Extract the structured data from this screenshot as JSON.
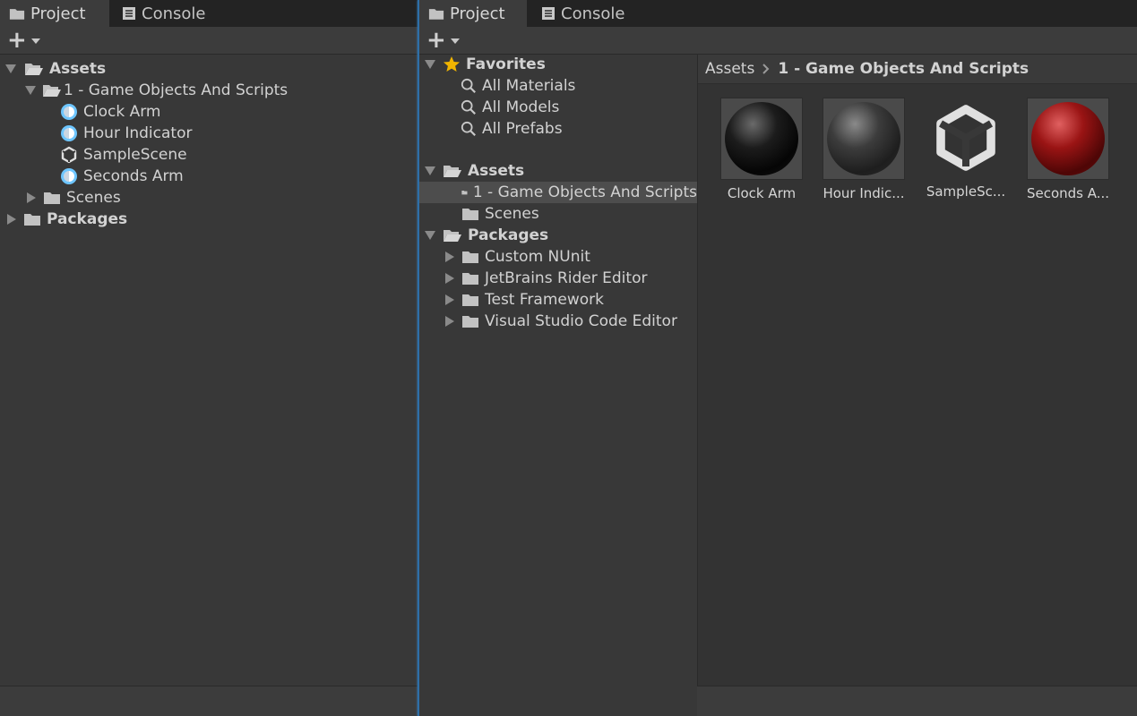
{
  "left": {
    "tabs": [
      {
        "label": "Project"
      },
      {
        "label": "Console"
      }
    ],
    "tree": {
      "assets": "Assets",
      "folder1": "1 - Game Objects And Scripts",
      "items": [
        "Clock Arm",
        "Hour Indicator",
        "SampleScene",
        "Seconds Arm"
      ],
      "scenes": "Scenes",
      "packages": "Packages"
    }
  },
  "right": {
    "tabs": [
      {
        "label": "Project"
      },
      {
        "label": "Console"
      }
    ],
    "favorites": {
      "label": "Favorites",
      "items": [
        "All Materials",
        "All Models",
        "All Prefabs"
      ]
    },
    "assets": {
      "label": "Assets",
      "children": [
        "1 - Game Objects And Scripts",
        "Scenes"
      ]
    },
    "packages": {
      "label": "Packages",
      "children": [
        "Custom NUnit",
        "JetBrains Rider Editor",
        "Test Framework",
        "Visual Studio Code Editor"
      ]
    },
    "breadcrumb": [
      "Assets",
      "1 - Game Objects And Scripts"
    ],
    "grid": [
      {
        "label": "Clock Arm",
        "color": "#1a1a1a"
      },
      {
        "label": "Hour Indic...",
        "color": "#3a3a3a"
      },
      {
        "label": "SampleSc...",
        "color": "#e6e6e6"
      },
      {
        "label": "Seconds A...",
        "color": "#8a1010"
      }
    ]
  },
  "colors": {
    "accent": "#3b86c8",
    "star": "#f0b400",
    "prefab": "#6ec6ff"
  }
}
